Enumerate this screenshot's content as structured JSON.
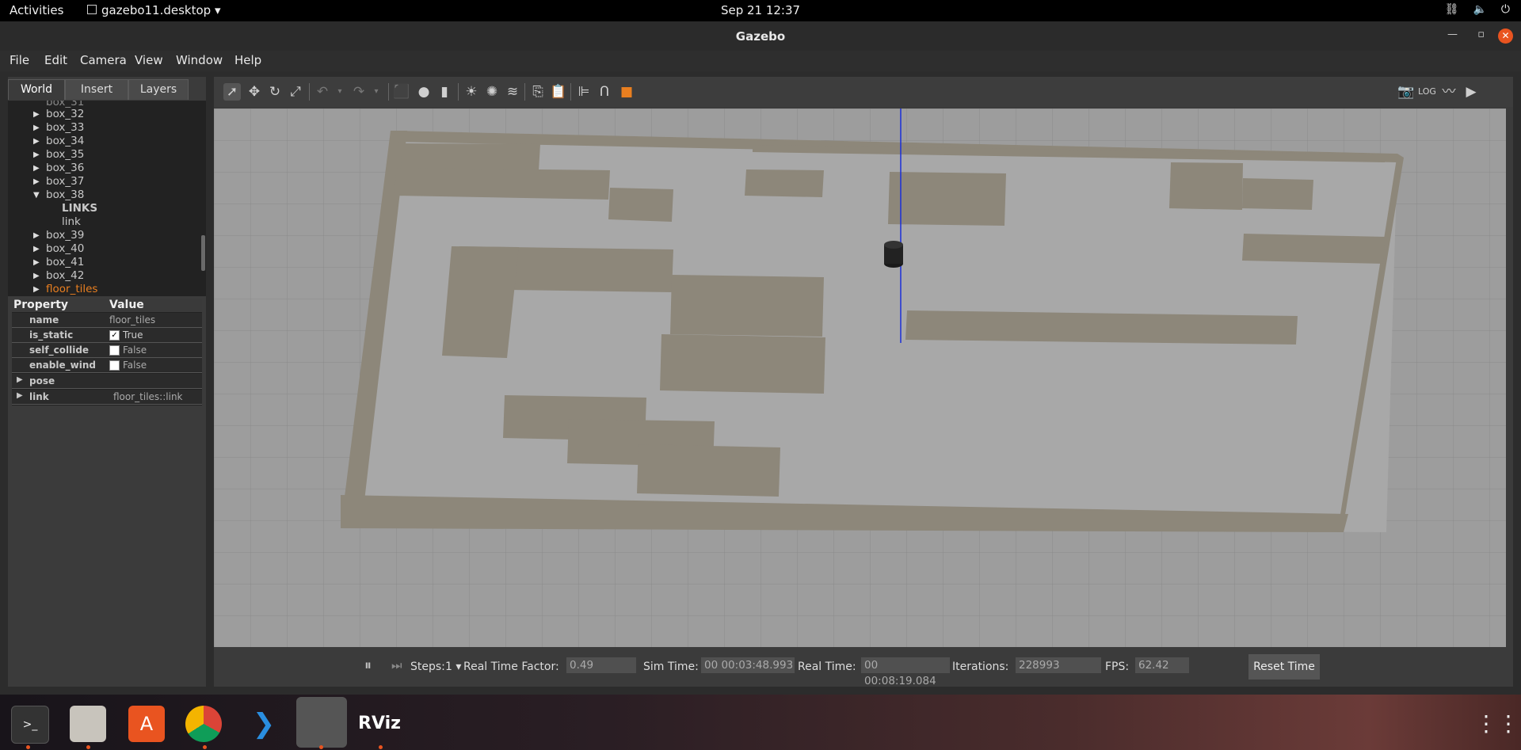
{
  "topbar": {
    "activities": "Activities",
    "app_name": "gazebo11.desktop ▾",
    "clock": "Sep 21  12:37"
  },
  "window": {
    "title": "Gazebo"
  },
  "menu": [
    "File",
    "Edit",
    "Camera",
    "View",
    "Window",
    "Help"
  ],
  "left_tabs": [
    "World",
    "Insert",
    "Layers"
  ],
  "tree": {
    "items": [
      "box_32",
      "box_33",
      "box_34",
      "box_35",
      "box_36",
      "box_37",
      "box_38"
    ],
    "box38_children": [
      "LINKS",
      "link"
    ],
    "items_after": [
      "box_39",
      "box_40",
      "box_41",
      "box_42"
    ],
    "selected": "floor_tiles"
  },
  "properties": {
    "header_property": "Property",
    "header_value": "Value",
    "name_key": "name",
    "name_val": "floor_tiles",
    "is_static_key": "is_static",
    "is_static_val": "True",
    "self_collide_key": "self_collide",
    "self_collide_val": "False",
    "enable_wind_key": "enable_wind",
    "enable_wind_val": "False",
    "pose_key": "pose",
    "link_key": "link",
    "link_val": "floor_tiles::link"
  },
  "bottom": {
    "steps_label": "Steps:",
    "steps_val": "1 ▾",
    "rtf_label": "Real Time Factor:",
    "rtf_val": "0.49",
    "sim_label": "Sim Time:",
    "sim_val": "00 00:03:48.993",
    "real_label": "Real Time:",
    "real_val": "00 00:08:19.084",
    "iter_label": "Iterations:",
    "iter_val": "228993",
    "fps_label": "FPS:",
    "fps_val": "62.42",
    "reset": "Reset Time"
  },
  "colors": {
    "accent": "#e95420",
    "scene_bg": "#9b9b9b",
    "wall_top": "#8f887a",
    "wall_side": "#d8d8d8"
  }
}
